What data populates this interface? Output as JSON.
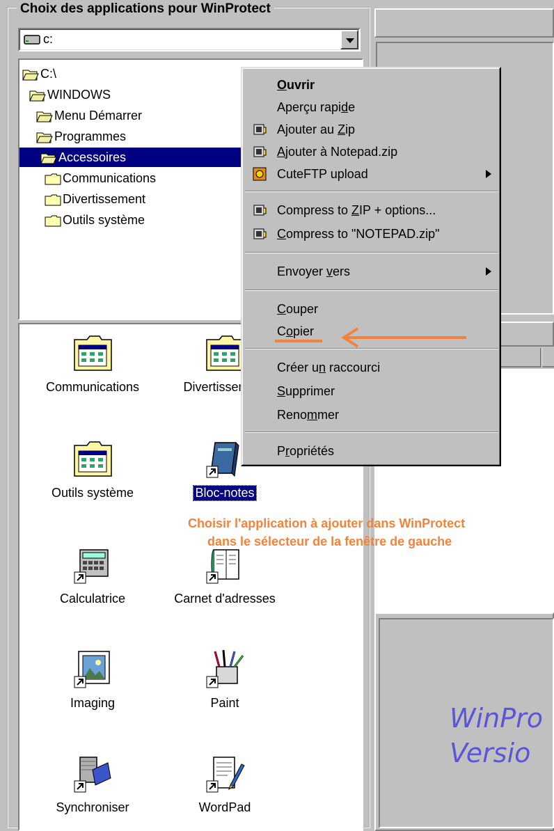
{
  "group": {
    "title": "Choix des applications pour WinProtect"
  },
  "drive": {
    "value": "c:"
  },
  "tree": {
    "items": [
      {
        "label": "C:\\",
        "level": 0,
        "open": true
      },
      {
        "label": "WINDOWS",
        "level": 1,
        "open": true
      },
      {
        "label": "Menu Démarrer",
        "level": 2,
        "open": true
      },
      {
        "label": "Programmes",
        "level": 3,
        "open": true
      },
      {
        "label": "Accessoires",
        "level": 4,
        "open": true,
        "selected": true
      },
      {
        "label": "Communications",
        "level": 5,
        "open": false
      },
      {
        "label": "Divertissement",
        "level": 5,
        "open": false
      },
      {
        "label": "Outils système",
        "level": 5,
        "open": false
      }
    ]
  },
  "icons": [
    {
      "label": "Communications",
      "icon": "folder-icon"
    },
    {
      "label": "Divertissement",
      "icon": "folder-icon"
    },
    {
      "label": "Outils système",
      "icon": "folder-icon"
    },
    {
      "label": "Bloc-notes",
      "icon": "notepad-icon",
      "selected": true
    },
    {
      "label": "Calculatrice",
      "icon": "calculator-icon"
    },
    {
      "label": "Carnet d'adresses",
      "icon": "address-book-icon"
    },
    {
      "label": "Imaging",
      "icon": "imaging-icon"
    },
    {
      "label": "Paint",
      "icon": "paint-icon"
    },
    {
      "label": "Synchroniser",
      "icon": "sync-icon"
    },
    {
      "label": "WordPad",
      "icon": "wordpad-icon"
    }
  ],
  "menu": {
    "ouvrir": {
      "pre": "",
      "u": "O",
      "post": "uvrir"
    },
    "apercu": {
      "pre": "Aperçu rapi",
      "u": "d",
      "post": "e"
    },
    "ajouter_zip": {
      "pre": "Ajouter au ",
      "u": "Z",
      "post": "ip"
    },
    "ajouter_notepad": {
      "pre": "",
      "u": "A",
      "post": "jouter à Notepad.zip"
    },
    "cuteftp": {
      "pre": "CuteFTP upload",
      "u": "",
      "post": ""
    },
    "compress_zip": {
      "pre": "Compress to ",
      "u": "Z",
      "post": "IP + options..."
    },
    "compress_notepad": {
      "pre": "",
      "u": "C",
      "post": "ompress to \"NOTEPAD.zip\""
    },
    "envoyer": {
      "pre": "Envoyer ",
      "u": "v",
      "post": "ers"
    },
    "couper": {
      "pre": "",
      "u": "C",
      "post": "ouper"
    },
    "copier": {
      "pre": "C",
      "u": "o",
      "post": "pier"
    },
    "raccourci": {
      "pre": "Créer u",
      "u": "n",
      "post": " raccourci"
    },
    "supprimer": {
      "pre": "",
      "u": "S",
      "post": "upprimer"
    },
    "renommer": {
      "pre": "Reno",
      "u": "m",
      "post": "mer"
    },
    "proprietes": {
      "pre": "P",
      "u": "r",
      "post": "opriétés"
    }
  },
  "annotation": {
    "line1": "Choisir l'application à ajouter dans WinProtect",
    "line2": "dans le sélecteur de la fenêtre de gauche",
    "color": "#f3833a"
  },
  "brand": {
    "line1": "WinPro",
    "line2": "Versio"
  }
}
